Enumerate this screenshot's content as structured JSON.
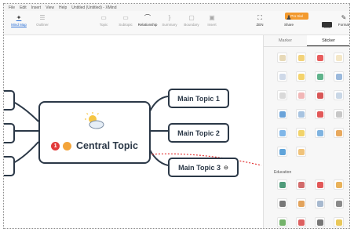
{
  "menubar": {
    "items": [
      "File",
      "Edit",
      "Insert",
      "View",
      "Help",
      "Untitled (Untitled) - XMind"
    ]
  },
  "toolbar": {
    "mindmap": "Mind Map",
    "outliner": "Outliner",
    "topic": "Topic",
    "subtopic": "Subtopic",
    "relationship": "Relationship",
    "summary": "Summary",
    "boundary": "Boundary",
    "insert": "Insert",
    "zen": "ZEN",
    "share": "Share",
    "icon": "Icon",
    "format": "Format",
    "pro": "Pro trial"
  },
  "central": {
    "label": "Central Topic",
    "badge": "1"
  },
  "topics": [
    "Main Topic 1",
    "Main Topic 2",
    "Main Topic 3"
  ],
  "panel": {
    "tab_marker": "Marker",
    "tab_sticker": "Sticker",
    "section": "Education"
  },
  "colors": {
    "accent": "#e23a3a",
    "node": "#2b3847",
    "pro": "#f39a2e"
  },
  "stickers": [
    [
      "alarm-clock",
      "#e7d9b8"
    ],
    [
      "gift",
      "#f2d27a"
    ],
    [
      "person",
      "#e85d5d"
    ],
    [
      "envelope",
      "#f4e7c7"
    ],
    [
      "document",
      "#cfd9e8"
    ],
    [
      "note",
      "#f4d36c"
    ],
    [
      "globe",
      "#5fb38b"
    ],
    [
      "calendar",
      "#9bb9dc"
    ],
    [
      "robot",
      "#d9d9d9"
    ],
    [
      "file",
      "#f1b6b6"
    ],
    [
      "book",
      "#d85656"
    ],
    [
      "chart-board",
      "#c9d7e6"
    ],
    [
      "camera",
      "#6aa3d9"
    ],
    [
      "magnifier",
      "#a7c3e0"
    ],
    [
      "target",
      "#e25858"
    ],
    [
      "gears",
      "#c7c7c7"
    ],
    [
      "clock",
      "#7fb6e8"
    ],
    [
      "bulb-chart",
      "#f1d36a"
    ],
    [
      "bar-chart",
      "#7fb3e0"
    ],
    [
      "badge",
      "#e8a95e"
    ],
    [
      "pointer",
      "#5fa3d9"
    ],
    [
      "people",
      "#f0c37b"
    ]
  ],
  "education": [
    [
      "blackboard",
      "#4f9b7a"
    ],
    [
      "student",
      "#d26b6b"
    ],
    [
      "flag",
      "#e25858"
    ],
    [
      "hourglass",
      "#e9b25a"
    ],
    [
      "glasses",
      "#777777"
    ],
    [
      "bottle",
      "#e2a35c"
    ],
    [
      "microscope",
      "#a7b9cf"
    ],
    [
      "headphones",
      "#8a8a8a"
    ],
    [
      "plant",
      "#74b36a"
    ],
    [
      "drop",
      "#dd6060"
    ],
    [
      "compass",
      "#777777"
    ],
    [
      "trophy",
      "#e9c85a"
    ]
  ]
}
